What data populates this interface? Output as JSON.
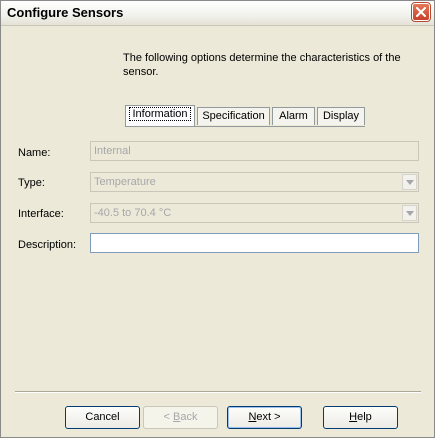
{
  "window": {
    "title": "Configure Sensors"
  },
  "intro": {
    "text": "The following options determine the characteristics of the sensor."
  },
  "tabs": [
    {
      "label": "Information",
      "active": true
    },
    {
      "label": "Specification",
      "active": false
    },
    {
      "label": "Alarm",
      "active": false
    },
    {
      "label": "Display",
      "active": false
    }
  ],
  "form": {
    "name": {
      "label": "Name:",
      "value": "Internal"
    },
    "type": {
      "label": "Type:",
      "value": "Temperature"
    },
    "interface": {
      "label": "Interface:",
      "value": "-40.5 to 70.4 °C"
    },
    "description": {
      "label": "Description:",
      "value": ""
    }
  },
  "buttons": {
    "cancel": {
      "label": "Cancel"
    },
    "back": {
      "label_prefix": "< ",
      "mnemonic": "B",
      "label_suffix": "ack"
    },
    "next": {
      "mnemonic": "N",
      "label_suffix": "ext >"
    },
    "help": {
      "mnemonic": "H",
      "label_suffix": "elp"
    }
  },
  "icons": {
    "close": "close-icon",
    "dropdown": "chevron-down-icon"
  },
  "colors": {
    "close_button": "#d9532f",
    "panel": "#ece9d8",
    "disabled_text": "#a7a6aa"
  }
}
